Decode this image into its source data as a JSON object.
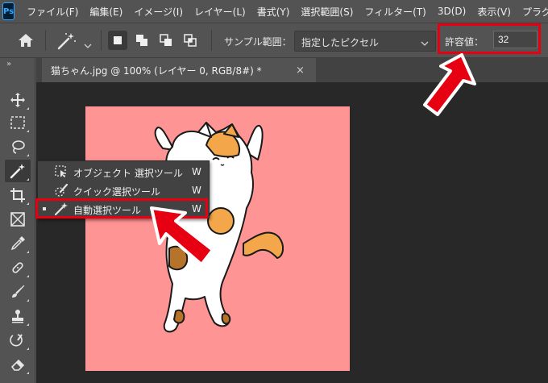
{
  "app": {
    "logo": "Ps"
  },
  "menu": [
    "ファイル(F)",
    "編集(E)",
    "イメージ(I)",
    "レイヤー(L)",
    "書式(Y)",
    "選択範囲(S)",
    "フィルター(T)",
    "3D(D)",
    "表示(V)",
    "プラグ-"
  ],
  "options": {
    "sample_label": "サンプル範囲：",
    "sample_value": "指定したピクセル",
    "tolerance_label": "許容値：",
    "tolerance_value": "32"
  },
  "tab": {
    "title": "猫ちゃん.jpg @ 100% (レイヤー 0, RGB/8#) *",
    "close": "×"
  },
  "toolbar": {
    "grip": "»"
  },
  "flyout": [
    {
      "label": "オブジェクト 選択ツール",
      "key": "W",
      "icon": "object-selection-icon"
    },
    {
      "label": "クイック選択ツール",
      "key": "W",
      "icon": "quick-selection-icon"
    },
    {
      "label": "自動選択ツール",
      "key": "W",
      "icon": "magic-wand-icon",
      "selected": true
    }
  ],
  "colors": {
    "accent_red": "#e60012",
    "canvas_bg": "#ff9494",
    "ui_bg": "#535353",
    "workspace_bg": "#282828"
  }
}
